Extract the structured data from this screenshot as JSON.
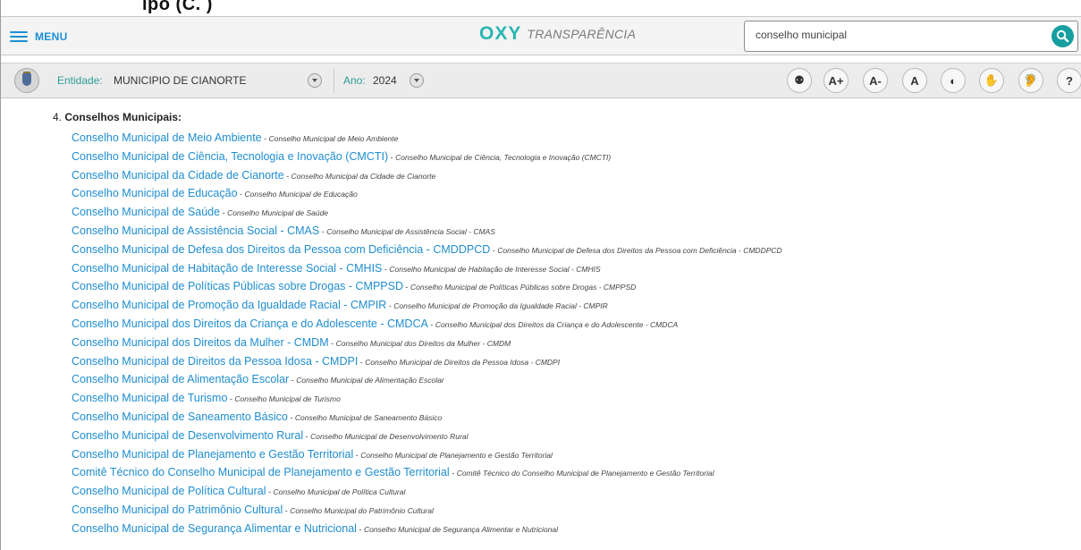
{
  "top_fragment": "ipo (C. )",
  "header": {
    "menu_label": "MENU",
    "brand_name": "OXY",
    "brand_subtitle": "TRANSPARÊNCIA",
    "search_value": "conselho municipal",
    "search_button_icon": "search-icon"
  },
  "toolbar": {
    "entity_label": "Entidade:",
    "entity_value": "MUNICIPIO DE CIANORTE",
    "year_label": "Ano:",
    "year_value": "2024",
    "accessibility": [
      {
        "name": "accessibility-icon",
        "label": "⚉"
      },
      {
        "name": "font-increase-button",
        "label": "A+"
      },
      {
        "name": "font-decrease-button",
        "label": "A-"
      },
      {
        "name": "font-reset-button",
        "label": "A"
      },
      {
        "name": "contrast-icon",
        "label": "◐"
      },
      {
        "name": "sign-language-icon",
        "label": "✋"
      },
      {
        "name": "hearing-icon",
        "label": "🦻"
      },
      {
        "name": "help-button",
        "label": "?"
      }
    ]
  },
  "content": {
    "section_number": "4.",
    "section_title": "Conselhos Municipais:",
    "separator": " - ",
    "items": [
      {
        "title": "Conselho Municipal de Meio Ambiente",
        "desc": "Conselho Municipal de Meio Ambiente"
      },
      {
        "title": "Conselho Municipal de Ciência, Tecnologia e Inovação (CMCTI)",
        "desc": "Conselho Municipal de Ciência, Tecnologia e Inovação (CMCTI)"
      },
      {
        "title": "Conselho Municipal da Cidade de Cianorte",
        "desc": "Conselho Municipal da Cidade de Cianorte"
      },
      {
        "title": "Conselho Municipal de Educação",
        "desc": "Conselho Municipal de Educação"
      },
      {
        "title": "Conselho Municipal de Saúde",
        "desc": "Conselho Municipal de Saúde"
      },
      {
        "title": "Conselho Municipal de Assistência Social - CMAS",
        "desc": "Conselho Municipal de Assistência Social - CMAS"
      },
      {
        "title": "Conselho Municipal de Defesa dos Direitos da Pessoa com Deficiência - CMDDPCD",
        "desc": "Conselho Municipal de Defesa dos Direitos da Pessoa com Deficiência - CMDDPCD"
      },
      {
        "title": "Conselho Municipal de Habitação de Interesse Social - CMHIS",
        "desc": "Conselho Municipal de Habitação de Interesse Social - CMHIS"
      },
      {
        "title": "Conselho Municipal de Políticas Públicas sobre Drogas - CMPPSD",
        "desc": "Conselho Municipal de Políticas Públicas sobre Drogas - CMPPSD"
      },
      {
        "title": "Conselho Municipal de Promoção da Igualdade Racial - CMPIR",
        "desc": "Conselho Municipal de Promoção da Igualdade Racial - CMPIR"
      },
      {
        "title": "Conselho Municipal dos Direitos da Criança e do Adolescente - CMDCA",
        "desc": "Conselho Municipal dos Direitos da Criança e do Adolescente - CMDCA"
      },
      {
        "title": "Conselho Municipal dos Direitos da Mulher - CMDM",
        "desc": "Conselho Municipal dos Direitos da Mulher - CMDM"
      },
      {
        "title": "Conselho Municipal de Direitos da Pessoa Idosa - CMDPI",
        "desc": "Conselho Municipal de Direitos da Pessoa Idosa - CMDPI"
      },
      {
        "title": "Conselho Municipal de Alimentação Escolar",
        "desc": "Conselho Municipal de Alimentação Escolar"
      },
      {
        "title": "Conselho Municipal de Turismo",
        "desc": "Conselho Municipal de Turismo"
      },
      {
        "title": "Conselho Municipal de Saneamento Básico",
        "desc": "Conselho Municipal de Saneamento Básico"
      },
      {
        "title": "Conselho Municipal de Desenvolvimento Rural",
        "desc": "Conselho Municipal de Desenvolvimento Rural"
      },
      {
        "title": "Conselho Municipal de Planejamento e Gestão Territorial",
        "desc": "Conselho Municipal de Planejamento e Gestão Territorial"
      },
      {
        "title": "Comitê Técnico do Conselho Municipal de Planejamento e Gestão Territorial",
        "desc": "Comitê Técnico do Conselho Municipal de Planejamento e Gestão Territorial"
      },
      {
        "title": "Conselho Municipal de Política Cultural",
        "desc": "Conselho Municipal de Política Cultural"
      },
      {
        "title": "Conselho Municipal do Patrimônio Cultural",
        "desc": "Conselho Municipal do Patrimônio Cultural"
      },
      {
        "title": "Conselho Municipal de Segurança Alimentar e Nutricional",
        "desc": "Conselho Municipal de Segurança Alimentar e Nutricional"
      }
    ]
  },
  "colors": {
    "link": "#1f8dcf",
    "accent": "#2f9c9a",
    "brand": "#28b6b0"
  }
}
